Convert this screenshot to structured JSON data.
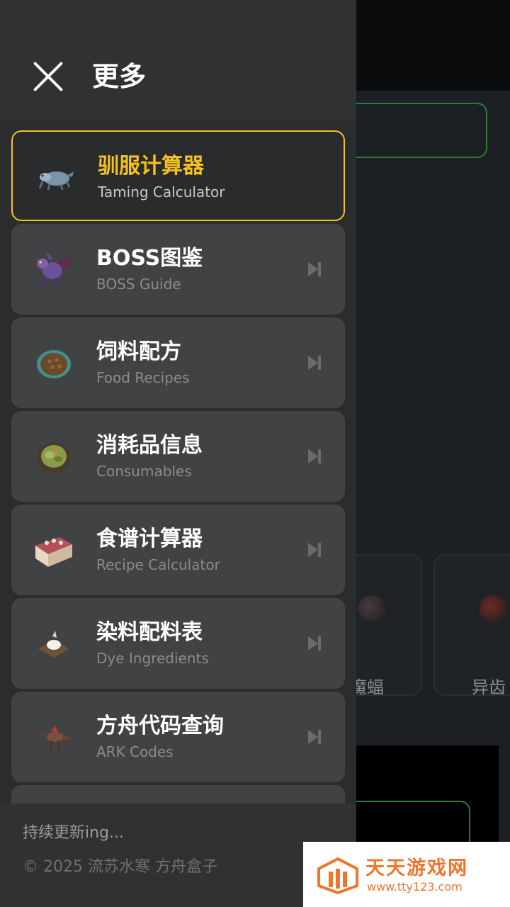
{
  "drawer": {
    "title": "更多",
    "items": [
      {
        "title": "驯服计算器",
        "subtitle": "Taming Calculator",
        "active": true,
        "icon": "taming-creature-icon"
      },
      {
        "title": "BOSS图鉴",
        "subtitle": "BOSS Guide",
        "active": false,
        "icon": "dragon-boss-icon"
      },
      {
        "title": "饲料配方",
        "subtitle": "Food Recipes",
        "active": false,
        "icon": "kibble-egg-icon"
      },
      {
        "title": "消耗品信息",
        "subtitle": "Consumables",
        "active": false,
        "icon": "soup-bowl-icon"
      },
      {
        "title": "食谱计算器",
        "subtitle": "Recipe Calculator",
        "active": false,
        "icon": "meat-cake-icon"
      },
      {
        "title": "染料配料表",
        "subtitle": "Dye Ingredients",
        "active": false,
        "icon": "dye-bowl-icon"
      },
      {
        "title": "方舟代码查询",
        "subtitle": "ARK Codes",
        "active": false,
        "icon": "raptor-icon"
      }
    ],
    "footer": {
      "update_text": "持续更新ing...",
      "copyright": "© 2025 流苏水寒 方舟盒子"
    }
  },
  "background": {
    "card_labels": [
      "魔蝠",
      "异齿"
    ]
  },
  "watermark": {
    "brand": "天天游戏网",
    "url": "www.tty123.com"
  },
  "colors": {
    "accent": "#f3c21d",
    "drawer_bg": "#2b2c2e",
    "item_bg": "#414244",
    "watermark": "#f0742a"
  }
}
